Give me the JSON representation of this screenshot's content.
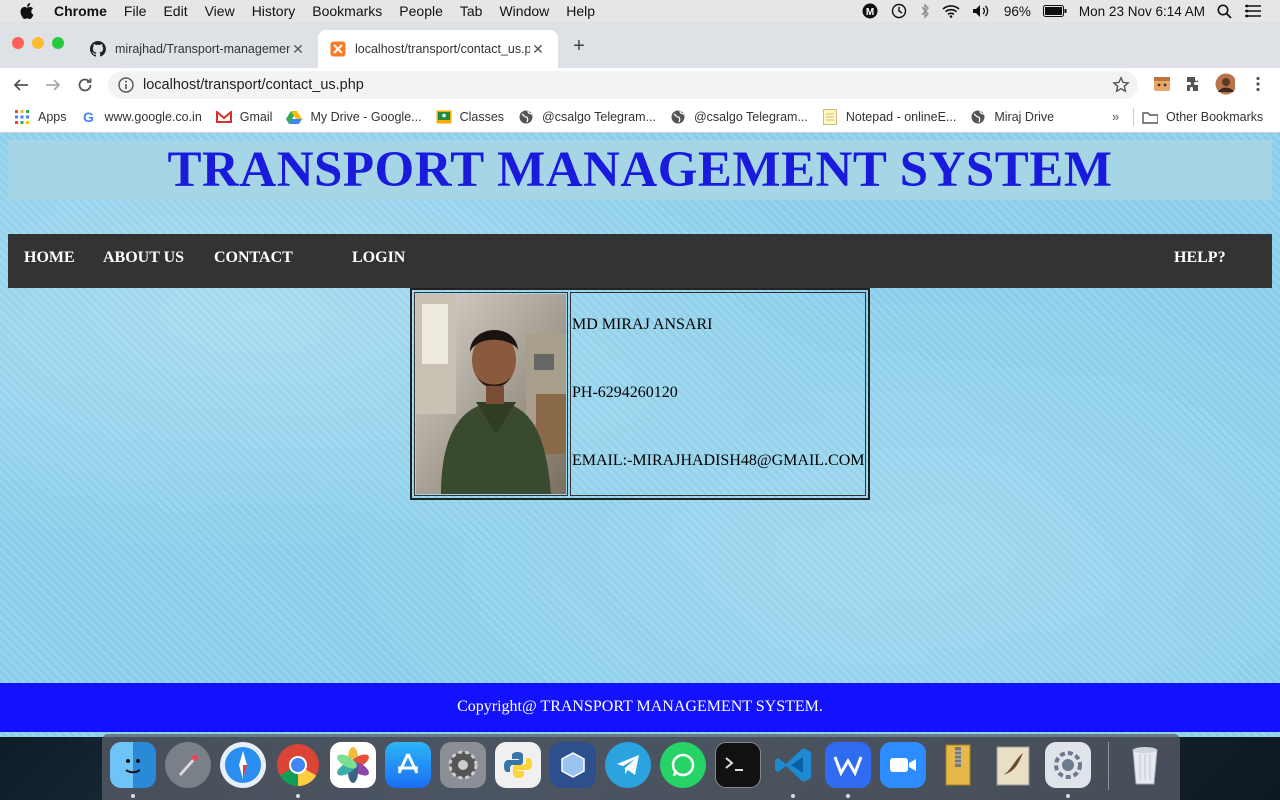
{
  "menubar": {
    "app_name": "Chrome",
    "items": [
      "File",
      "Edit",
      "View",
      "History",
      "Bookmarks",
      "People",
      "Tab",
      "Window",
      "Help"
    ],
    "battery": "96%",
    "datetime": "Mon 23 Nov  6:14 AM"
  },
  "tabs": [
    {
      "title": "mirajhad/Transport-management",
      "icon": "github-icon"
    },
    {
      "title": "localhost/transport/contact_us.php",
      "icon": "xampp-icon",
      "active": true
    }
  ],
  "omnibox": {
    "url": "localhost/transport/contact_us.php"
  },
  "bookmarks": {
    "items": [
      {
        "label": "Apps",
        "icon": "apps-grid-icon"
      },
      {
        "label": "www.google.co.in",
        "icon": "google-icon"
      },
      {
        "label": "Gmail",
        "icon": "gmail-icon"
      },
      {
        "label": "My Drive - Google...",
        "icon": "drive-icon"
      },
      {
        "label": "Classes",
        "icon": "classroom-icon"
      },
      {
        "label": "@csalgo Telegram...",
        "icon": "globe-icon"
      },
      {
        "label": "@csalgo Telegram...",
        "icon": "globe-icon"
      },
      {
        "label": "Notepad - onlineE...",
        "icon": "notepad-icon"
      },
      {
        "label": "Miraj Drive",
        "icon": "globe-icon"
      }
    ],
    "more": "»",
    "other": "Other Bookmarks"
  },
  "page": {
    "title": "TRANSPORT MANAGEMENT SYSTEM",
    "nav": {
      "home": "HOME",
      "about": "ABOUT US",
      "contact": "CONTACT",
      "login": "LOGIN",
      "help": "HELP?"
    },
    "contact": {
      "name": "MD MIRAJ ANSARI",
      "phone": "PH-6294260120",
      "email": "EMAIL:-MIRAJHADISH48@GMAIL.COM"
    },
    "footer": "Copyright@ TRANSPORT MANAGEMENT SYSTEM."
  },
  "dock": [
    "finder-icon",
    "launchpad-icon",
    "safari-icon",
    "chrome-icon",
    "photos-icon",
    "app-store-icon",
    "system-preferences-icon",
    "python-icon",
    "virtualbox-icon",
    "telegram-icon",
    "whatsapp-icon",
    "terminal-icon",
    "vscode-icon",
    "wps-icon",
    "zoom-icon",
    "archive-icon",
    "mail-icon",
    "utility-icon",
    "trash-icon"
  ]
}
